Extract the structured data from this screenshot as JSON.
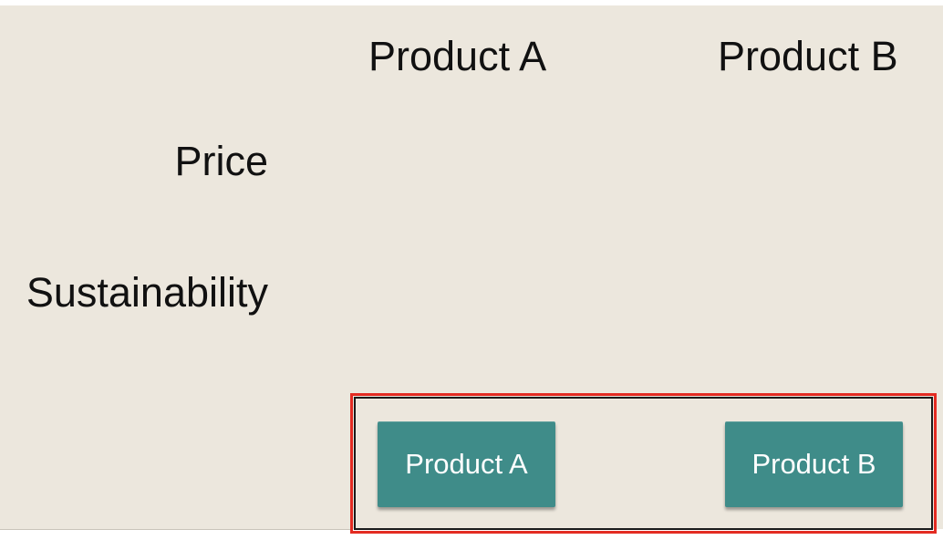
{
  "table": {
    "columns": [
      "Product A",
      "Product B"
    ],
    "rows": [
      "Price",
      "Sustainability"
    ]
  },
  "choice": {
    "button_a": "Product A",
    "button_b": "Product B"
  },
  "colors": {
    "panel_bg": "#ece7dd",
    "button_bg": "#3f8c89",
    "highlight_border": "#e32b22"
  }
}
